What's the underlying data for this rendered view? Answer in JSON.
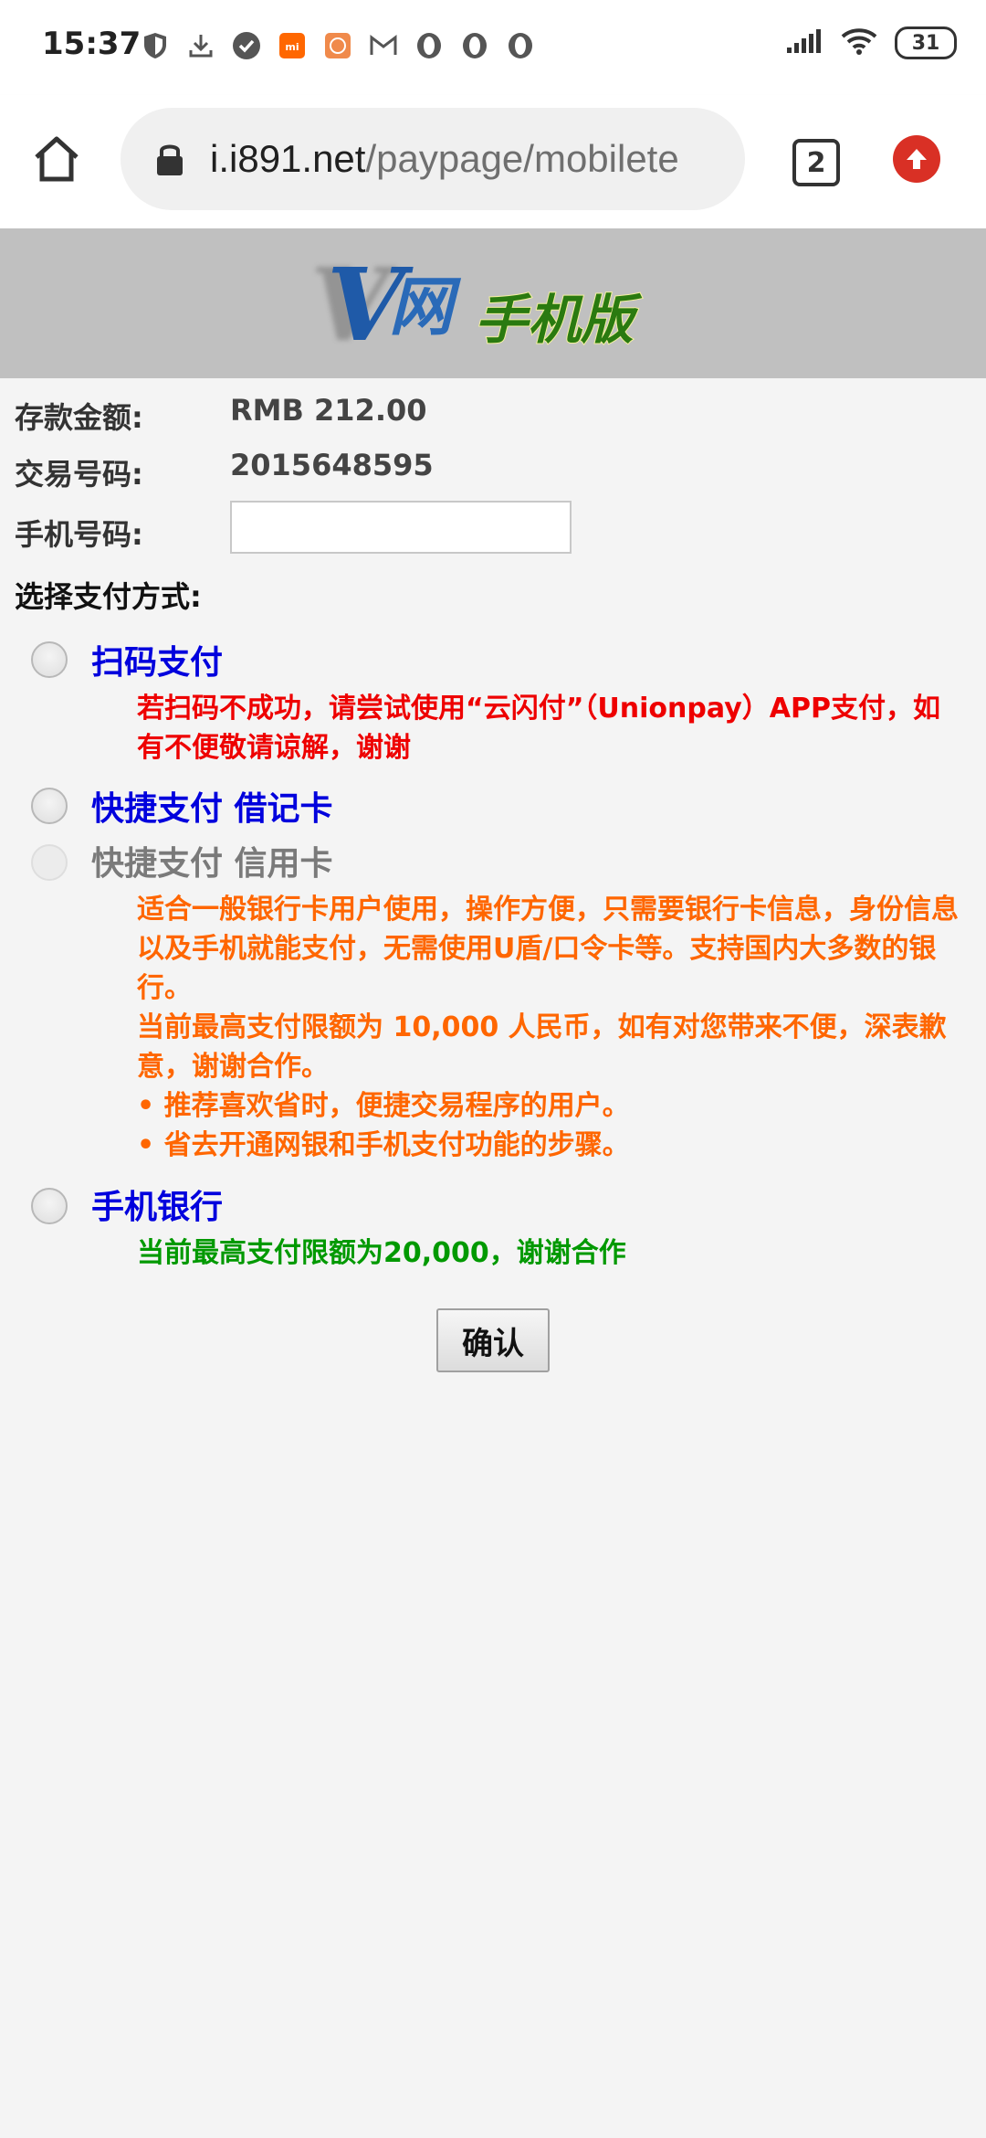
{
  "status_bar": {
    "time": "15:37",
    "icons_left": [
      "shield-icon",
      "download-icon",
      "check-circle-icon",
      "mi-icon",
      "app-icon",
      "gmail-icon",
      "opera-icon",
      "opera-icon",
      "opera-icon"
    ],
    "battery": "31"
  },
  "browser": {
    "url_host": "i.i891.net",
    "url_path": "/paypage/mobilete",
    "tab_count": "2"
  },
  "banner": {
    "logo_text": "手机版"
  },
  "form": {
    "amount_label": "存款金额:",
    "amount_value": "RMB 212.00",
    "txn_label": "交易号码:",
    "txn_value": "2015648595",
    "phone_label": "手机号码:",
    "phone_value": "",
    "method_label": "选择支付方式:"
  },
  "payment_options": [
    {
      "label": "扫码支付",
      "note": "若扫码不成功，请尝试使用“云闪付”（Unionpay）APP支付，如有不便敬请谅解，谢谢"
    },
    {
      "label": "快捷支付 借记卡"
    },
    {
      "label": "快捷支付 信用卡",
      "note_lines": [
        "适合一般银行卡用户使用，操作方便，只需要银行卡信息，身份信息以及手机就能支付，无需使用U盾/口令卡等。支持国内大多数的银行。",
        "当前最高支付限额为 10,000 人民币，如有对您带来不便，深表歉意，谢谢合作。",
        "• 推荐喜欢省时，便捷交易程序的用户。",
        "• 省去开通网银和手机支付功能的步骤。"
      ]
    },
    {
      "label": "手机银行",
      "note": "当前最高支付限额为20,000，谢谢合作"
    }
  ],
  "confirm_label": "确认",
  "colors": {
    "option_blue": "#0000dd",
    "note_red": "#ee0000",
    "note_orange": "#ff6600",
    "note_green": "#009900",
    "banner_gray": "#c0c0c0"
  }
}
